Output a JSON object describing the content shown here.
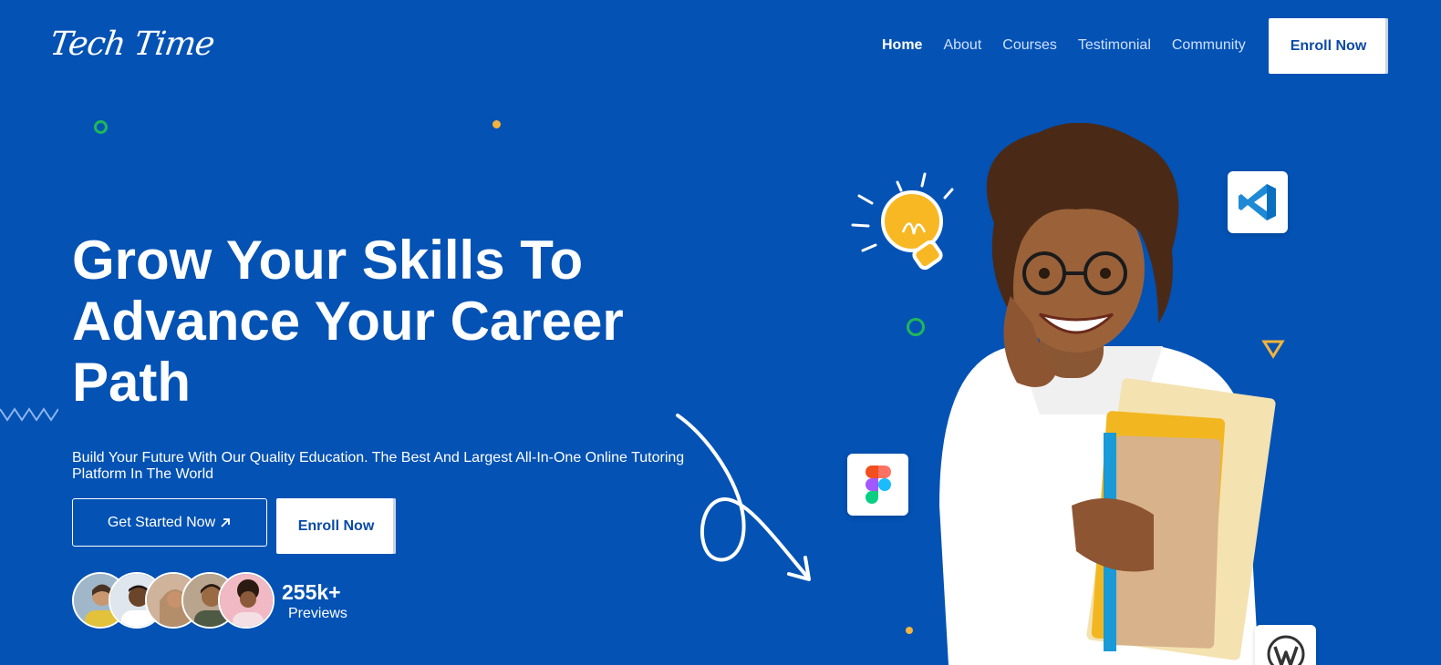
{
  "brand": {
    "logo_text": "Tech Time"
  },
  "nav": {
    "items": [
      {
        "label": "Home",
        "active": true
      },
      {
        "label": "About",
        "active": false
      },
      {
        "label": "Courses",
        "active": false
      },
      {
        "label": "Testimonial",
        "active": false
      },
      {
        "label": "Community",
        "active": false
      }
    ],
    "cta_label": "Enroll Now"
  },
  "hero": {
    "title_line1": "Grow Your Skills To",
    "title_line2": "Advance Your Career",
    "title_line3": "Path",
    "subtitle": "Build Your Future With Our Quality Education. The Best And Largest All-In-One Online Tutoring Platform In The World",
    "primary_button": "Get Started Now",
    "primary_button_icon": "arrow-up-right-icon",
    "secondary_button": "Enroll Now",
    "stat_value": "255k+",
    "stat_label": "Previews"
  },
  "tools": [
    "vscode-icon",
    "figma-icon",
    "wordpress-icon"
  ],
  "colors": {
    "background": "#0352b4",
    "accent_text": "#0b4aa6",
    "ring_green": "#1fb85a",
    "dot_yellow": "#f5b33a"
  }
}
